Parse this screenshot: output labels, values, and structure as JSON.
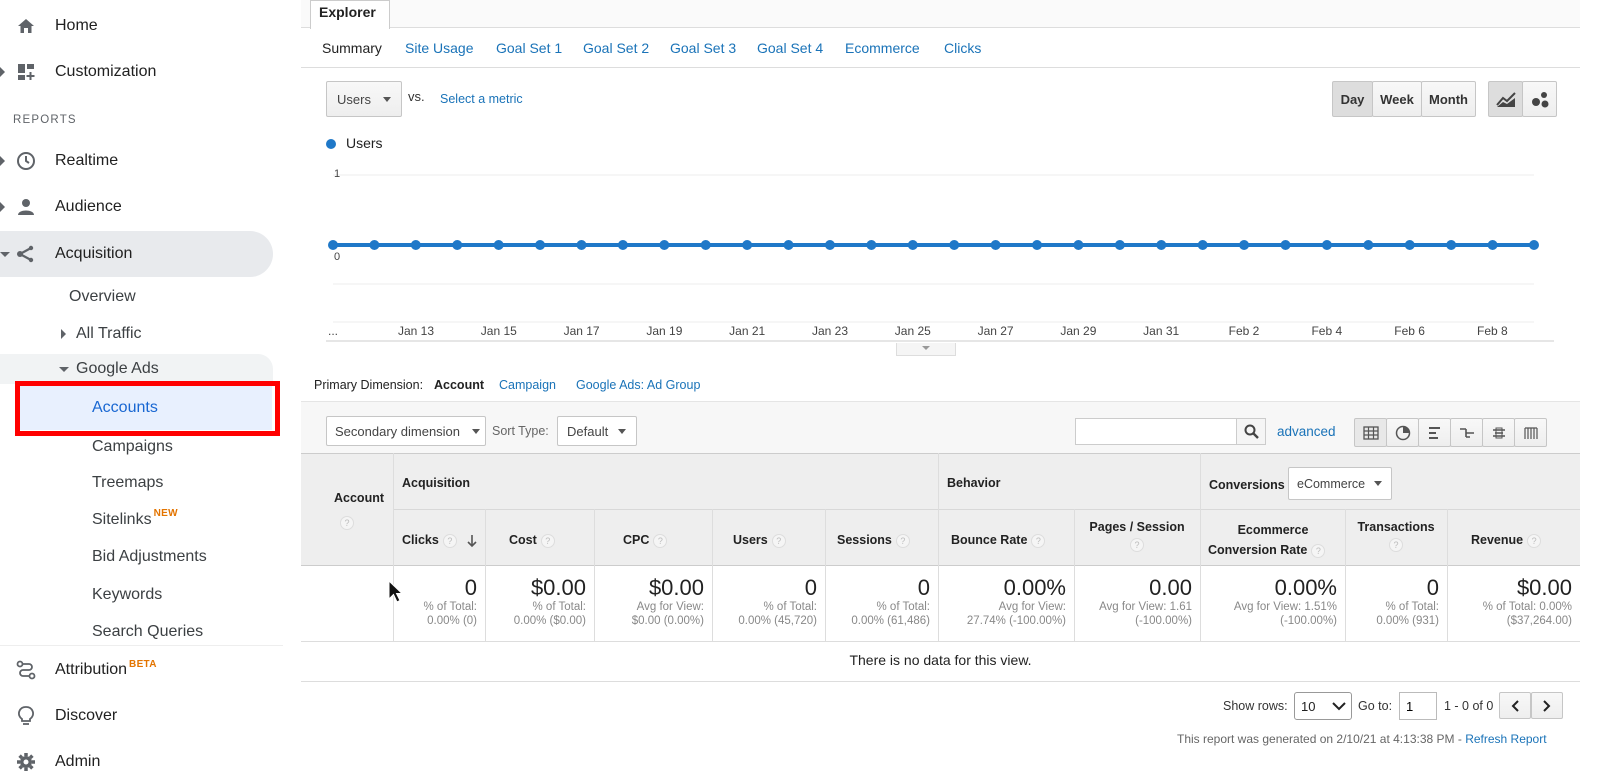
{
  "sidebar": {
    "top_items": [
      {
        "label": "Home",
        "icon": "home-icon"
      },
      {
        "label": "Customization",
        "icon": "dashboard-icon"
      }
    ],
    "reports_header": "REPORTS",
    "report_items": [
      {
        "label": "Realtime",
        "icon": "clock-icon"
      },
      {
        "label": "Audience",
        "icon": "person-icon"
      },
      {
        "label": "Acquisition",
        "icon": "acquisition-icon"
      }
    ],
    "acquisition_sub": {
      "overview": "Overview",
      "all_traffic": "All Traffic",
      "google_ads": "Google Ads"
    },
    "google_ads_items": [
      "Accounts",
      "Campaigns",
      "Treemaps",
      "Sitelinks",
      "Bid Adjustments",
      "Keywords",
      "Search Queries"
    ],
    "sitelinks_badge": "NEW",
    "bottom_items": [
      {
        "label": "Attribution",
        "icon": "attribution-icon",
        "badge": "BETA"
      },
      {
        "label": "Discover",
        "icon": "lightbulb-icon"
      },
      {
        "label": "Admin",
        "icon": "gear-icon"
      }
    ],
    "highlight_color": "#ff0000",
    "selected_color": "#1967d2"
  },
  "explorer": {
    "tab": "Explorer",
    "subtabs": [
      "Summary",
      "Site Usage",
      "Goal Set 1",
      "Goal Set 2",
      "Goal Set 3",
      "Goal Set 4",
      "Ecommerce",
      "Clicks"
    ],
    "metric": "Users",
    "vs": "vs.",
    "select_metric": "Select a metric",
    "period_buttons": [
      "Day",
      "Week",
      "Month"
    ]
  },
  "chart_data": {
    "type": "line",
    "series": [
      {
        "name": "Users",
        "values": [
          0,
          0,
          0,
          0,
          0,
          0,
          0,
          0,
          0,
          0,
          0,
          0,
          0,
          0,
          0,
          0,
          0,
          0,
          0,
          0,
          0,
          0,
          0,
          0,
          0,
          0,
          0,
          0,
          0,
          0
        ]
      }
    ],
    "ylim": [
      0,
      1
    ],
    "ytick_labels": [
      "1",
      "0"
    ],
    "xtick_labels": [
      "...",
      "Jan 13",
      "Jan 15",
      "Jan 17",
      "Jan 19",
      "Jan 21",
      "Jan 23",
      "Jan 25",
      "Jan 27",
      "Jan 29",
      "Jan 31",
      "Feb 2",
      "Feb 4",
      "Feb 6",
      "Feb 8"
    ],
    "color": "#1f78c8"
  },
  "dimension": {
    "label": "Primary Dimension:",
    "active": "Account",
    "options": [
      "Campaign",
      "Google Ads: Ad Group"
    ]
  },
  "toolbar": {
    "secondary": "Secondary dimension",
    "sort_label": "Sort Type:",
    "sort_value": "Default",
    "search_placeholder": "",
    "advanced": "advanced"
  },
  "table": {
    "account_header": "Account",
    "groups": {
      "acquisition": "Acquisition",
      "behavior": "Behavior",
      "conversions": "Conversions"
    },
    "conversions_select": "eCommerce",
    "columns": [
      {
        "label": "Clicks",
        "value": "0",
        "sub1": "% of Total:",
        "sub2": "0.00% (0)"
      },
      {
        "label": "Cost",
        "value": "$0.00",
        "sub1": "% of Total:",
        "sub2": "0.00% ($0.00)"
      },
      {
        "label": "CPC",
        "value": "$0.00",
        "sub1": "Avg for View:",
        "sub2": "$0.00 (0.00%)"
      },
      {
        "label": "Users",
        "value": "0",
        "sub1": "% of Total:",
        "sub2": "0.00% (45,720)"
      },
      {
        "label": "Sessions",
        "value": "0",
        "sub1": "% of Total:",
        "sub2": "0.00% (61,486)"
      },
      {
        "label": "Bounce Rate",
        "value": "0.00%",
        "sub1": "Avg for View:",
        "sub2": "27.74% (-100.00%)"
      },
      {
        "label": "Pages / Session",
        "value": "0.00",
        "sub1": "Avg for View: 1.61",
        "sub2": "(-100.00%)"
      },
      {
        "label1": "Ecommerce",
        "label2": "Conversion Rate",
        "value": "0.00%",
        "sub1": "Avg for View: 1.51%",
        "sub2": "(-100.00%)"
      },
      {
        "label": "Transactions",
        "value": "0",
        "sub1": "% of Total:",
        "sub2": "0.00% (931)"
      },
      {
        "label": "Revenue",
        "value": "$0.00",
        "sub1": "% of Total: 0.00%",
        "sub2": "($37,264.00)"
      }
    ],
    "empty_message": "There is no data for this view."
  },
  "pagination": {
    "show_rows": "Show rows:",
    "rows_value": "10",
    "goto": "Go to:",
    "goto_value": "1",
    "range": "1 - 0 of 0"
  },
  "footer": {
    "generated": "This report was generated on 2/10/21 at 4:13:38 PM -",
    "refresh": "Refresh Report"
  }
}
